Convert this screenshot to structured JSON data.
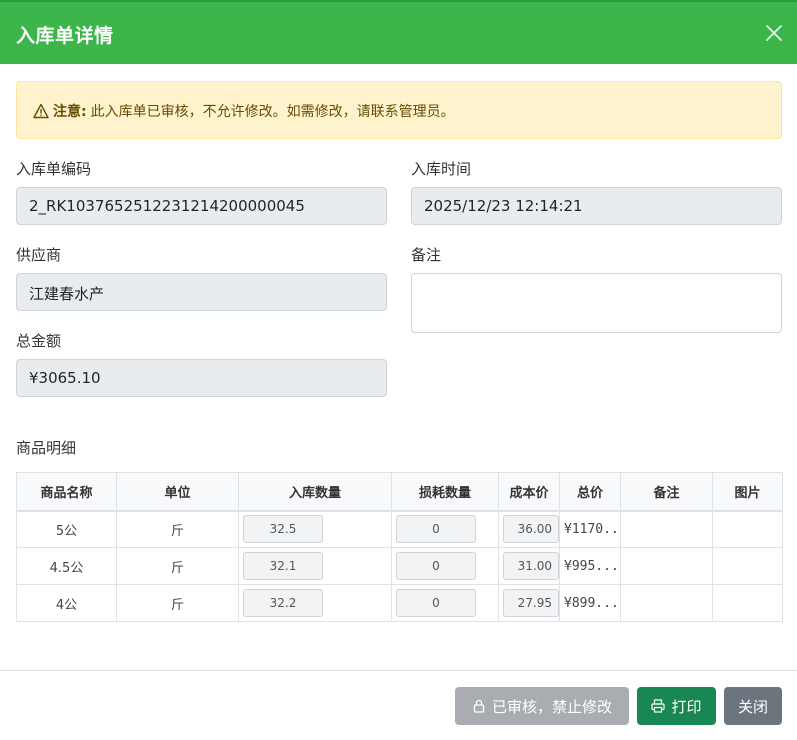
{
  "header": {
    "title": "入库单详情",
    "close_icon": "close-icon"
  },
  "alert": {
    "icon": "warning-icon",
    "strong": "注意:",
    "message": "此入库单已审核，不允许修改。如需修改，请联系管理员。"
  },
  "form": {
    "code_label": "入库单编码",
    "code_value": "2_RK1037652512231214200000045",
    "time_label": "入库时间",
    "time_value": "2025/12/23 12:14:21",
    "supplier_label": "供应商",
    "supplier_value": "江建春水产",
    "remark_label": "备注",
    "remark_value": "",
    "total_label": "总金额",
    "total_value": "¥3065.10"
  },
  "items": {
    "section_title": "商品明细",
    "columns": [
      "商品名称",
      "单位",
      "入库数量",
      "损耗数量",
      "成本价",
      "总价",
      "备注",
      "图片"
    ],
    "rows": [
      {
        "name": "5公",
        "unit": "斤",
        "qty": "32.5",
        "loss": "0",
        "cost": "36.00",
        "total": "¥1170...",
        "remark": "",
        "image": ""
      },
      {
        "name": "4.5公",
        "unit": "斤",
        "qty": "32.1",
        "loss": "0",
        "cost": "31.00",
        "total": "¥995....",
        "remark": "",
        "image": ""
      },
      {
        "name": "4公",
        "unit": "斤",
        "qty": "32.2",
        "loss": "0",
        "cost": "27.95",
        "total": "¥899....",
        "remark": "",
        "image": ""
      }
    ]
  },
  "buttons": {
    "locked_label": "已审核，禁止修改",
    "locked_icon": "lock-icon",
    "print_label": "打印",
    "print_icon": "printer-icon",
    "close_label": "关闭"
  },
  "colors": {
    "header": "#3cb54a",
    "alert_bg": "#fff3cd",
    "print_button": "#198754",
    "close_button": "#6c757d",
    "locked_button": "#a9adb2"
  }
}
